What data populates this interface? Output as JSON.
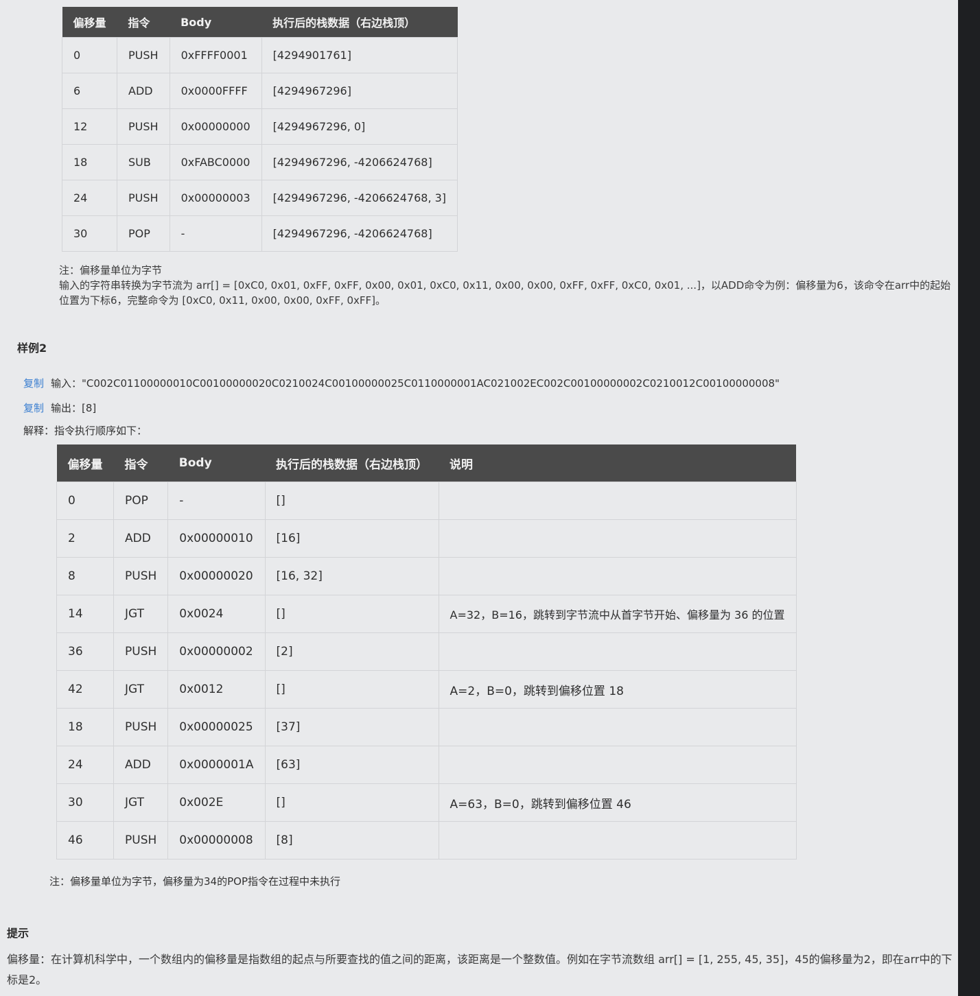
{
  "table1": {
    "headers": [
      "偏移量",
      "指令",
      "Body",
      "执行后的栈数据（右边栈顶）"
    ],
    "rows": [
      [
        "0",
        "PUSH",
        "0xFFFF0001",
        "[4294901761]"
      ],
      [
        "6",
        "ADD",
        "0x0000FFFF",
        "[4294967296]"
      ],
      [
        "12",
        "PUSH",
        "0x00000000",
        "[4294967296, 0]"
      ],
      [
        "18",
        "SUB",
        "0xFABC0000",
        "[4294967296, -4206624768]"
      ],
      [
        "24",
        "PUSH",
        "0x00000003",
        "[4294967296, -4206624768, 3]"
      ],
      [
        "30",
        "POP",
        "-",
        "[4294967296, -4206624768]"
      ]
    ]
  },
  "note1": {
    "line1": "注：偏移量单位为字节",
    "line2": "输入的字符串转换为字节流为 arr[] = [0xC0, 0x01, 0xFF, 0xFF, 0x00, 0x01, 0xC0, 0x11, 0x00, 0x00, 0xFF, 0xFF, 0xC0, 0x01, ...]，以ADD命令为例：偏移量为6，该命令在arr中的起始位置为下标6，完整命令为 [0xC0, 0x11, 0x00, 0x00, 0xFF, 0xFF]。"
  },
  "example2": {
    "title": "样例2",
    "copy_label": "复制",
    "input": "输入：\"C002C01100000010C00100000020C0210024C00100000025C0110000001AC021002EC002C00100000002C0210012C00100000008\"",
    "output": "输出：[8]",
    "explain": "解释：指令执行顺序如下："
  },
  "table2": {
    "headers": [
      "偏移量",
      "指令",
      "Body",
      "执行后的栈数据（右边栈顶）",
      "说明"
    ],
    "rows": [
      [
        "0",
        "POP",
        "-",
        "[]",
        ""
      ],
      [
        "2",
        "ADD",
        "0x00000010",
        "[16]",
        ""
      ],
      [
        "8",
        "PUSH",
        "0x00000020",
        "[16, 32]",
        ""
      ],
      [
        "14",
        "JGT",
        "0x0024",
        "[]",
        "A=32，B=16，跳转到字节流中从首字节开始、偏移量为 36 的位置"
      ],
      [
        "36",
        "PUSH",
        "0x00000002",
        "[2]",
        ""
      ],
      [
        "42",
        "JGT",
        "0x0012",
        "[]",
        "A=2，B=0，跳转到偏移位置 18"
      ],
      [
        "18",
        "PUSH",
        "0x00000025",
        "[37]",
        ""
      ],
      [
        "24",
        "ADD",
        "0x0000001A",
        "[63]",
        ""
      ],
      [
        "30",
        "JGT",
        "0x002E",
        "[]",
        "A=63，B=0，跳转到偏移位置 46"
      ],
      [
        "46",
        "PUSH",
        "0x00000008",
        "[8]",
        ""
      ]
    ]
  },
  "note2": "注：偏移量单位为字节，偏移量为34的POP指令在过程中未执行",
  "hint": {
    "title": "提示",
    "text": "偏移量：在计算机科学中，一个数组内的偏移量是指数组的起点与所要查找的值之间的距离，该距离是一个整数值。例如在字节流数组 arr[] = [1, 255, 45, 35]，45的偏移量为2，即在arr中的下标是2。"
  }
}
